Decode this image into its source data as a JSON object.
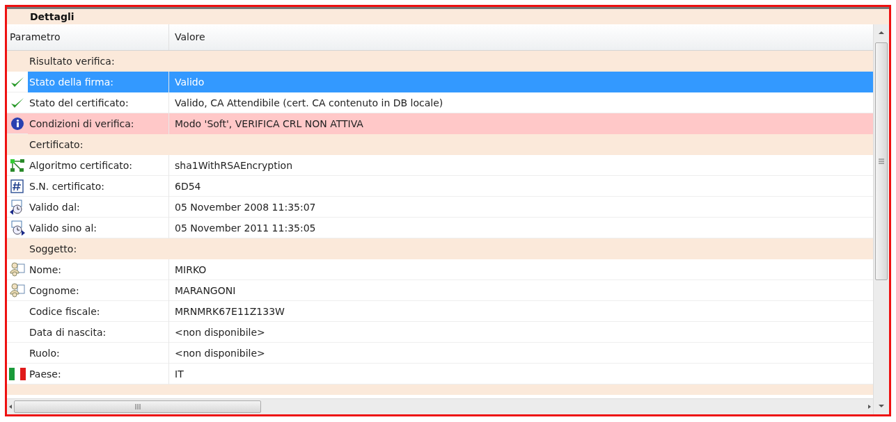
{
  "panel": {
    "title": "Dettagli"
  },
  "columns": [
    "Parametro",
    "Valore"
  ],
  "rows": [
    {
      "kind": "section",
      "label": "Risultato verifica:"
    },
    {
      "kind": "check",
      "label": "Stato della firma:",
      "value": "Valido",
      "selected": true,
      "highlighted": false
    },
    {
      "kind": "check",
      "label": "Stato del certificato:",
      "value": "Valido, CA Attendibile (cert. CA contenuto in DB locale)",
      "selected": false,
      "highlighted": false
    },
    {
      "kind": "info",
      "label": "Condizioni di verifica:",
      "value": "Modo 'Soft', VERIFICA CRL NON ATTIVA",
      "selected": false,
      "highlighted": true
    },
    {
      "kind": "section",
      "label": "Certificato:"
    },
    {
      "kind": "algorithm",
      "label": "Algoritmo certificato:",
      "value": "sha1WithRSAEncryption",
      "selected": false,
      "highlighted": false
    },
    {
      "kind": "serial",
      "label": "S.N. certificato:",
      "value": "6D54",
      "selected": false,
      "highlighted": false
    },
    {
      "kind": "start",
      "label": "Valido dal:",
      "value": "05 November 2008 11:35:07",
      "selected": false,
      "highlighted": false
    },
    {
      "kind": "end",
      "label": "Valido sino al:",
      "value": "05 November 2011 11:35:05",
      "selected": false,
      "highlighted": false
    },
    {
      "kind": "section",
      "label": "Soggetto:"
    },
    {
      "kind": "person",
      "label": "Nome:",
      "value": "MIRKO",
      "selected": false,
      "highlighted": false
    },
    {
      "kind": "person",
      "label": "Cognome:",
      "value": "MARANGONI",
      "selected": false,
      "highlighted": false
    },
    {
      "kind": "plain",
      "label": "Codice fiscale:",
      "value": "MRNMRK67E11Z133W",
      "selected": false,
      "highlighted": false
    },
    {
      "kind": "plain",
      "label": "Data di nascita:",
      "value": "<non disponibile>",
      "selected": false,
      "highlighted": false
    },
    {
      "kind": "plain",
      "label": "Ruolo:",
      "value": "<non disponibile>",
      "selected": false,
      "highlighted": false
    },
    {
      "kind": "flag",
      "label": "Paese:",
      "value": "IT",
      "selected": false,
      "highlighted": false
    },
    {
      "kind": "partial"
    }
  ]
}
